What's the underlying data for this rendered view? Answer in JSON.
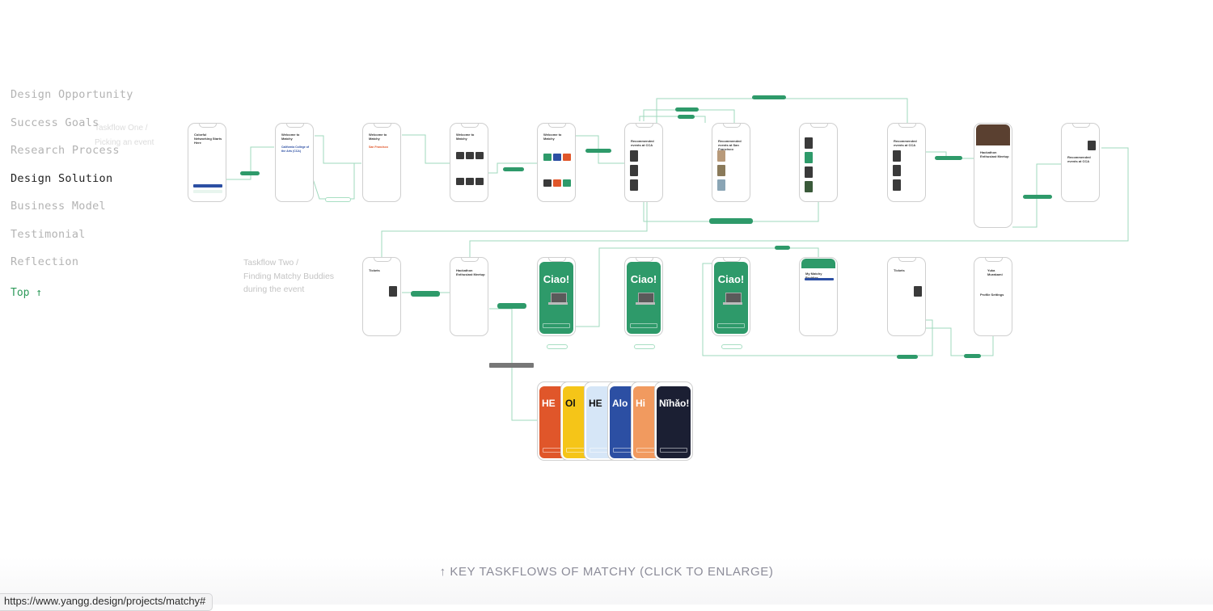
{
  "sidebar": {
    "items": [
      {
        "label": "Design Opportunity",
        "active": false
      },
      {
        "label": "Success Goals",
        "active": false
      },
      {
        "label": "Research Process",
        "active": false
      },
      {
        "label": "Design Solution",
        "active": true
      },
      {
        "label": "Business Model",
        "active": false
      },
      {
        "label": "Testimonial",
        "active": false
      },
      {
        "label": "Reflection",
        "active": false
      }
    ],
    "top_label": "Top ↑"
  },
  "taskflow_one": {
    "line1": "Taskflow One /",
    "line2": "Picking an event"
  },
  "taskflow_two": {
    "line1": "Taskflow Two /",
    "line2": "Finding Matchy Buddies",
    "line3": "during the event"
  },
  "screens": {
    "onboarding": {
      "title": "Colorful Networking Starts Here"
    },
    "welcome": {
      "title": "Welcome to Matchy",
      "school": "California College of the Arts (CCA)",
      "city": "San Francisco"
    },
    "recommended": {
      "title": "Recommended events at CCA",
      "title_sf": "Recommended events at San Francisco"
    },
    "event": {
      "title": "Hackathon Enthusiast Meetup"
    },
    "tickets": {
      "title": "Tickets"
    },
    "buddies": {
      "title": "My Matchy Buddies"
    },
    "profile": {
      "name": "Yuka Murakami",
      "section": "Profile Settings"
    },
    "greeting": {
      "label": "Ciao!"
    },
    "greetings_variants": [
      "HE",
      "Ol",
      "HE",
      "Alo",
      "Hi",
      "Nǐhǎo!"
    ]
  },
  "greeting_colors": [
    "#e0562a",
    "#f5c518",
    "#d6e6f7",
    "#2c4fa3",
    "#f19a5f",
    "#1b1f33"
  ],
  "accent_color": "#2e9a6a",
  "caption": "↑ KEY TASKFLOWS OF MATCHY (CLICK TO ENLARGE)",
  "status_url": "https://www.yangg.design/projects/matchy#"
}
